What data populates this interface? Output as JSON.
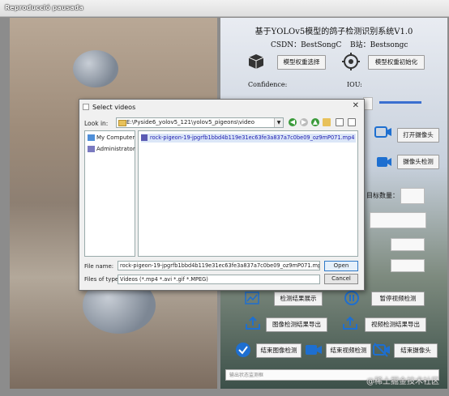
{
  "window": {
    "title": "Reproducció pausada"
  },
  "app": {
    "title": "基于YOLOv5模型的鸽子检测识别系统V1.0",
    "csdn": "CSDN：BestSongC",
    "bilibili": "B站：Bestsongc",
    "buttons": {
      "model_select": "模型权重选择",
      "model_init": "模型权重初始化",
      "open_camera": "打开摄像头",
      "camera_detect": "摄像头检测",
      "show_results": "检测结果展示",
      "pause_video": "暂停视频检测",
      "export_image": "图像检测结果导出",
      "export_video": "视频检测结果导出",
      "end_image": "结束图像检测",
      "end_video": "结束视频检测",
      "end_camera": "结束摄像头"
    },
    "labels": {
      "confidence": "Confidence:",
      "iou": "IOU:",
      "target_count": "目标数量："
    },
    "status_placeholder": "输出状态监测框",
    "watermark": "@稀土掘金技术社区"
  },
  "dialog": {
    "title": "Select videos",
    "look_in_label": "Look in:",
    "look_in_path": "E:\\Pyside6_yolov5_121\\yolov5_pigeons\\video",
    "sidebar": [
      {
        "label": "My Computer",
        "icon": "computer-icon"
      },
      {
        "label": "Administrator",
        "icon": "user-icon"
      }
    ],
    "files": [
      "rock-pigeon-19-jpgrfb1bbd4b119e31ec63fe3a837a7c0be09_oz9mP071.mp4"
    ],
    "file_name_label": "File name:",
    "file_name_value": "rock-pigeon-19-jpgrfb1bbd4b119e31ec63fe3a837a7c0be09_oz9mP071.mp4",
    "file_type_label": "Files of type:",
    "file_type_value": "Videos (*.mp4 *.avi *.gif *.MPEG)",
    "open_label": "Open",
    "cancel_label": "Cancel"
  },
  "colors": {
    "accent_blue": "#1e6fd0",
    "dialog_bg": "#f0f0f0"
  }
}
